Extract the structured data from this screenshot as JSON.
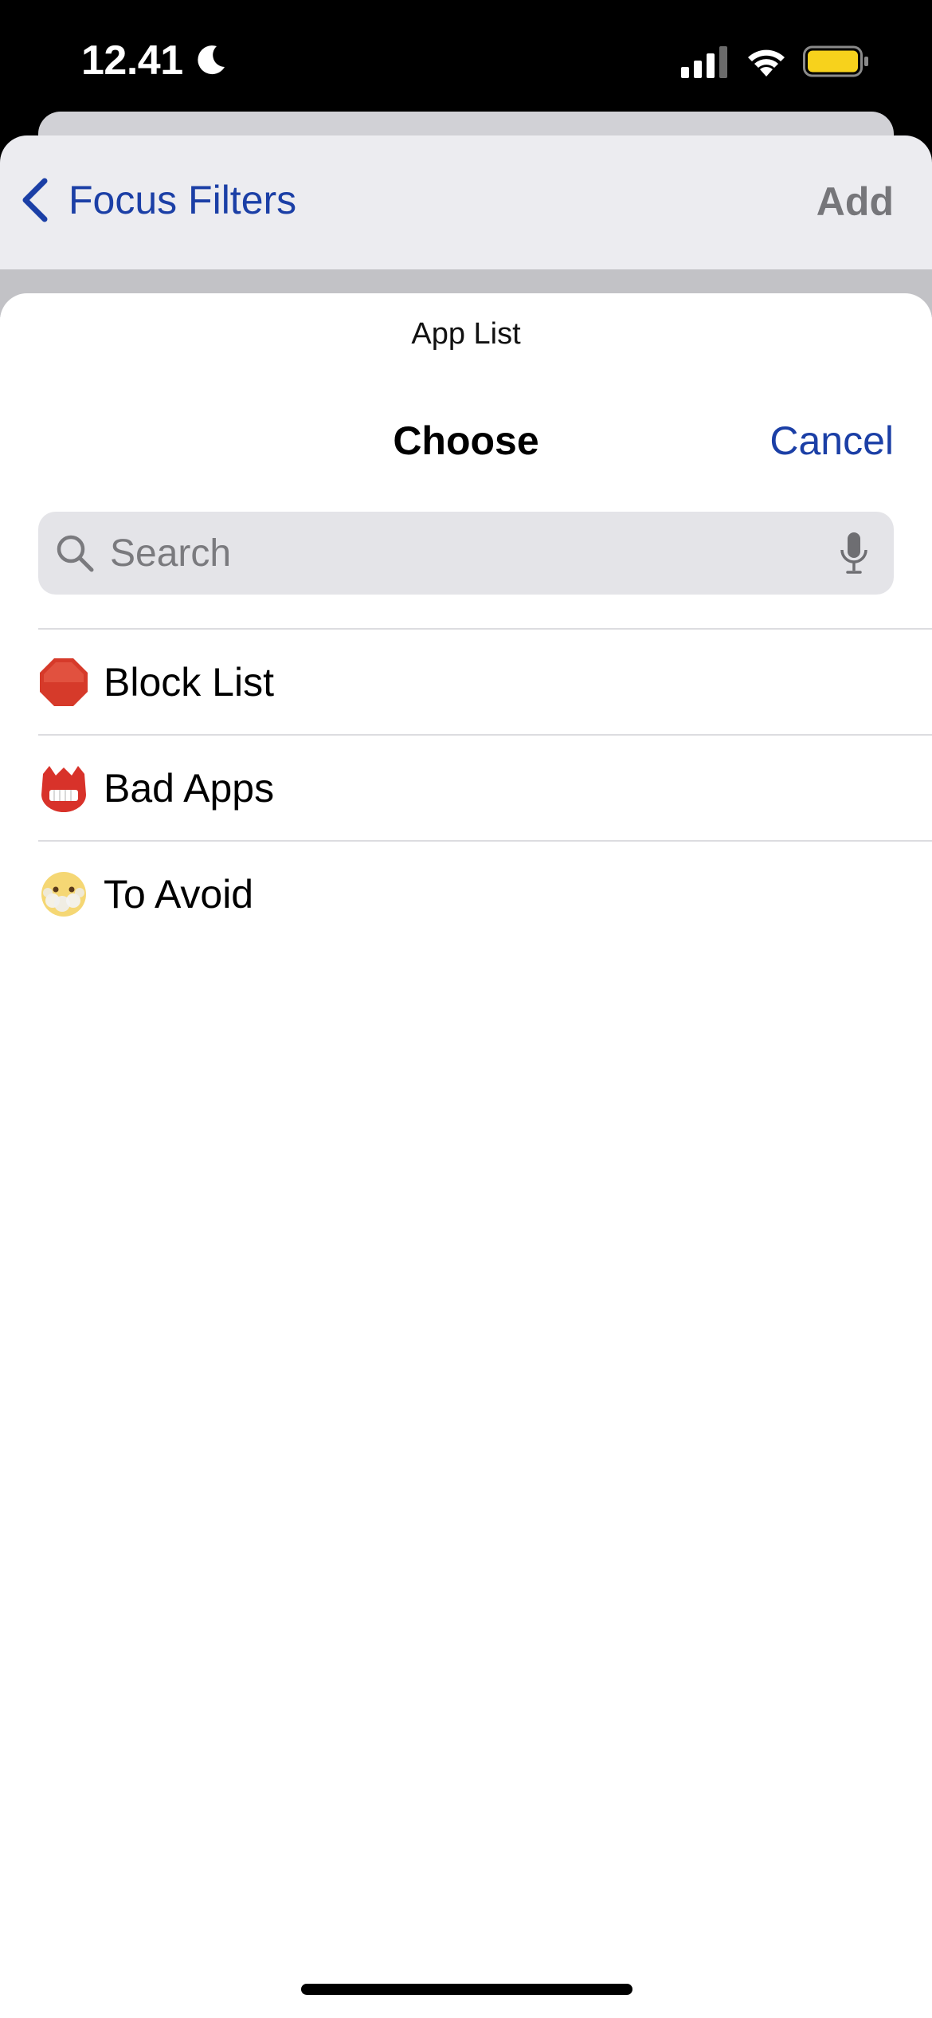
{
  "status_bar": {
    "time": "12.41",
    "battery_color": "#f7d21c"
  },
  "nav": {
    "back_label": "Focus Filters",
    "add_label": "Add"
  },
  "sheet": {
    "subtitle": "App List",
    "title": "Choose",
    "cancel_label": "Cancel"
  },
  "search": {
    "placeholder": "Search",
    "value": ""
  },
  "list": {
    "items": [
      {
        "label": "Block List",
        "icon": "stop-sign-icon"
      },
      {
        "label": "Bad Apps",
        "icon": "ogre-mask-icon"
      },
      {
        "label": "To Avoid",
        "icon": "exhale-face-icon"
      }
    ]
  },
  "colors": {
    "accent": "#1b3fa6",
    "disabled": "#76767a"
  }
}
